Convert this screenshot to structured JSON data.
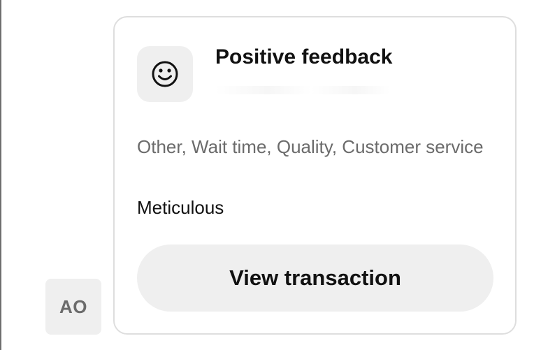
{
  "avatar": {
    "initials": "AO"
  },
  "card": {
    "icon": "smiley-face-icon",
    "title": "Positive feedback",
    "tags": "Other, Wait time, Quality, Customer service",
    "comment": "Meticulous",
    "button_label": "View transaction"
  },
  "colors": {
    "card_border": "#dedede",
    "muted_background": "#efefef",
    "muted_text": "#6b6b6b",
    "primary_text": "#111111"
  }
}
